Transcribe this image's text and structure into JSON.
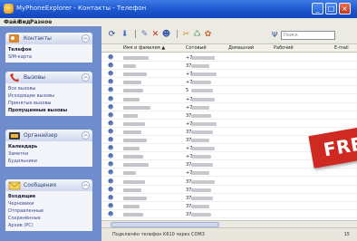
{
  "window": {
    "title": "MyPhoneExplorer - Контакты - Телефон"
  },
  "menu": [
    "Файл",
    "Вид",
    "Разное"
  ],
  "sidebar": {
    "groups": [
      {
        "title": "Контакты",
        "items": [
          {
            "label": "Телефон",
            "bold": true
          },
          {
            "label": "SIM-карта",
            "bold": false
          }
        ]
      },
      {
        "title": "Вызовы",
        "items": [
          {
            "label": "Все вызовы",
            "bold": false
          },
          {
            "label": "Исходящие вызовы",
            "bold": false
          },
          {
            "label": "Принятые вызовы",
            "bold": false
          },
          {
            "label": "Пропущенные вызовы",
            "bold": true
          }
        ]
      },
      {
        "title": "Органайзер",
        "items": [
          {
            "label": "Календарь",
            "bold": true
          },
          {
            "label": "Заметки",
            "bold": false
          },
          {
            "label": "Будильники",
            "bold": false
          }
        ]
      },
      {
        "title": "Сообщения",
        "items": [
          {
            "label": "Входящие",
            "bold": true
          },
          {
            "label": "Черновики",
            "bold": false
          },
          {
            "label": "Отправленные",
            "bold": false
          },
          {
            "label": "Сохранённые",
            "bold": false
          },
          {
            "label": "Архив (PC)",
            "bold": false
          }
        ]
      }
    ]
  },
  "search": {
    "placeholder": "Поиск"
  },
  "grid": {
    "columns": [
      "Имя и фамилия",
      "Сотовый",
      "Домашний",
      "Рабочий",
      "E-mail"
    ],
    "sort_indicator": "▲",
    "rows": [
      {
        "phone": "+7"
      },
      {
        "phone": "37"
      },
      {
        "phone": "+7"
      },
      {
        "phone": "+7"
      },
      {
        "phone": "5"
      },
      {
        "phone": "+7"
      },
      {
        "phone": "+7"
      },
      {
        "phone": "37"
      },
      {
        "phone": "+7"
      },
      {
        "phone": "37"
      },
      {
        "phone": "37"
      },
      {
        "phone": "+7"
      },
      {
        "phone": "+7"
      },
      {
        "phone": "37"
      },
      {
        "phone": "+7"
      },
      {
        "phone": "37"
      },
      {
        "phone": "37"
      },
      {
        "phone": "37"
      },
      {
        "phone": "37"
      },
      {
        "phone": "37"
      }
    ]
  },
  "status": {
    "connection": "Подключён телефон K610 через COM3",
    "count": "15"
  },
  "banner": {
    "text": "FREE"
  }
}
